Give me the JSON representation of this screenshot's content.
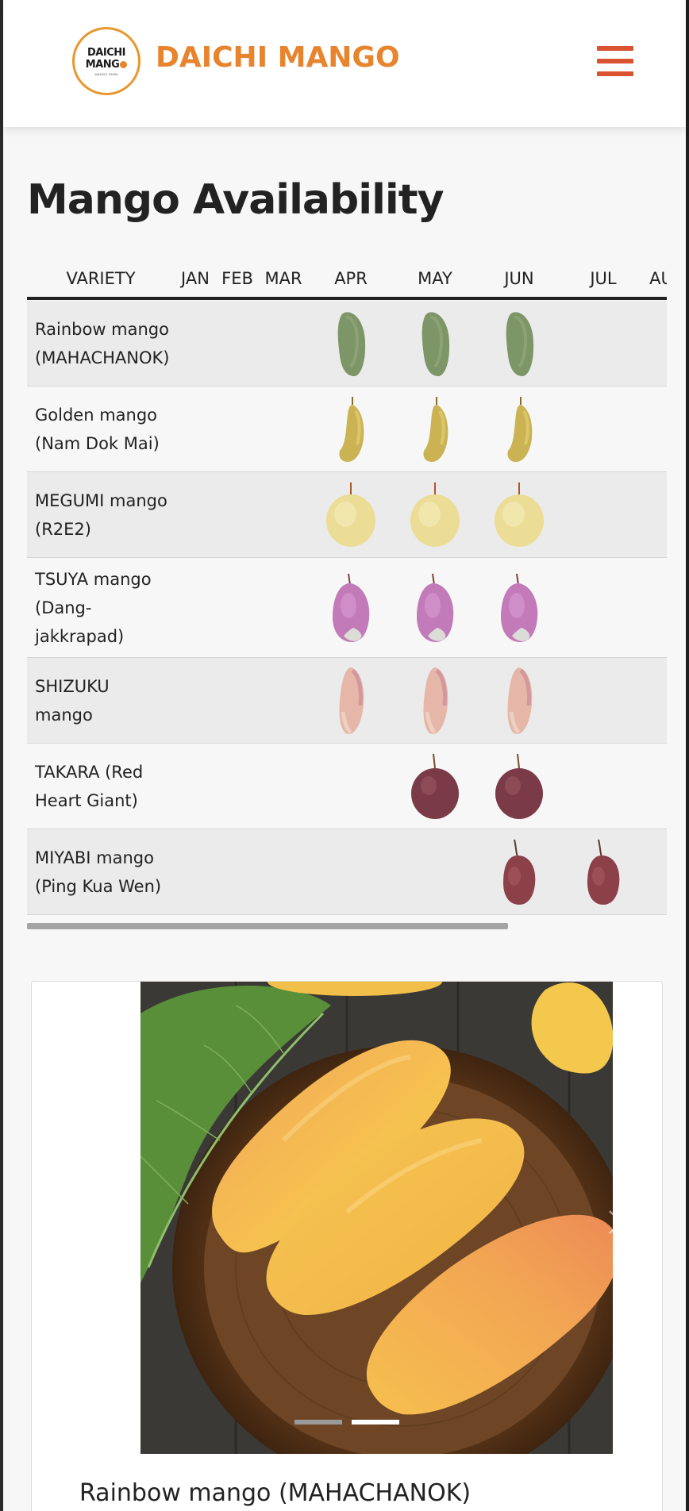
{
  "header": {
    "logo_line1": "DAICHI",
    "logo_line2": "MANG",
    "logo_line3": "MANGO FARM",
    "brand_name": "DAICHI MANGO",
    "brand_color": "#e8832e",
    "menu_icon": "hamburger-icon",
    "menu_color": "#d95330"
  },
  "page": {
    "title": "Mango Availability"
  },
  "table": {
    "columns": [
      "VARIETY",
      "JAN",
      "FEB",
      "MAR",
      "APR",
      "MAY",
      "JUN",
      "JUL",
      "AU"
    ],
    "rows": [
      {
        "label": "Rainbow mango (MAHACHANOK)",
        "months": [
          "APR",
          "MAY",
          "JUN"
        ],
        "icon": "green-mango-icon"
      },
      {
        "label": "Golden mango (Nam Dok Mai)",
        "months": [
          "APR",
          "MAY",
          "JUN"
        ],
        "icon": "golden-mango-icon"
      },
      {
        "label": "MEGUMI mango (R2E2)",
        "months": [
          "APR",
          "MAY",
          "JUN"
        ],
        "icon": "pale-yellow-mango-icon"
      },
      {
        "label": "TSUYA mango (Dang-jakkrapad)",
        "months": [
          "APR",
          "MAY",
          "JUN"
        ],
        "icon": "pink-mango-icon"
      },
      {
        "label": "SHIZUKU mango",
        "months": [
          "APR",
          "MAY",
          "JUN"
        ],
        "icon": "pink-long-mango-icon"
      },
      {
        "label": "TAKARA (Red Heart Giant)",
        "months": [
          "MAY",
          "JUN"
        ],
        "icon": "red-round-mango-icon"
      },
      {
        "label": "MIYABI mango (Ping Kua Wen)",
        "months": [
          "JUN",
          "JUL"
        ],
        "icon": "red-small-mango-icon"
      }
    ]
  },
  "slider": {
    "caption": "Rainbow mango (MAHACHANOK)",
    "slide_count": 2,
    "active_slide": 2,
    "next_icon": "chevron-right-icon"
  }
}
